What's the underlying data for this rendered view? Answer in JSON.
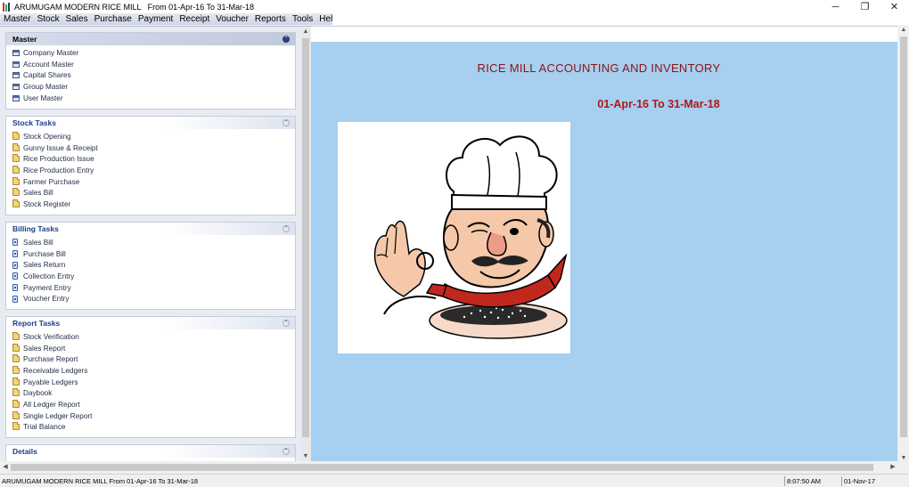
{
  "window": {
    "title": "ARUMUGAM MODERN RICE MILL   From 01-Apr-16 To 31-Mar-18",
    "minimize": "─",
    "restore": "❐",
    "close": "✕"
  },
  "menu": [
    {
      "label": "Master"
    },
    {
      "label": "Stock"
    },
    {
      "label": "Sales"
    },
    {
      "label": "Purchase"
    },
    {
      "label": "Payment"
    },
    {
      "label": "Receipt"
    },
    {
      "label": "Voucher"
    },
    {
      "label": "Reports"
    },
    {
      "label": "Tools"
    },
    {
      "label": "Help"
    }
  ],
  "taskpane": {
    "groups": [
      {
        "title": "Master",
        "icon": "window-icon",
        "items": [
          "Company Master",
          "Account Master",
          "Capital Shares",
          "Group Master",
          "User Master"
        ]
      },
      {
        "title": "Stock Tasks",
        "icon": "folder-icon",
        "items": [
          "Stock Opening",
          "Gunny Issue & Receipt",
          "Rice Production Issue",
          "Rice Production Entry",
          "Farmer Purchase",
          "Sales Bill",
          "Stock Register"
        ]
      },
      {
        "title": "Billing Tasks",
        "icon": "document-icon",
        "items": [
          "Sales Bill",
          "Purchase Bill",
          "Sales Return",
          "Collection Entry",
          "Payment Entry",
          "Voucher Entry"
        ]
      },
      {
        "title": "Report Tasks",
        "icon": "folder-icon",
        "items": [
          "Stock Verification",
          "Sales Report",
          "Purchase Report",
          "Receivable Ledgers",
          "Payable Ledgers",
          "Daybook",
          "All Ledger Report",
          "Single Ledger Report",
          "Trial Balance"
        ]
      },
      {
        "title": "Details",
        "icon": "",
        "items": []
      }
    ]
  },
  "main": {
    "heading": "RICE MILL ACCOUNTING AND INVENTORY",
    "period": "01-Apr-16  To  31-Mar-18",
    "image_icon": "chef-illustration"
  },
  "status": {
    "company": "ARUMUGAM MODERN RICE MILL   From 01-Apr-16 To 31-Mar-18",
    "time": "8:07:50 AM",
    "date": "01-Nov-17"
  },
  "colors": {
    "main_bg": "#a6cff0",
    "heading": "#8b1414",
    "period": "#b01818",
    "group_title": "#1a3e8c"
  }
}
